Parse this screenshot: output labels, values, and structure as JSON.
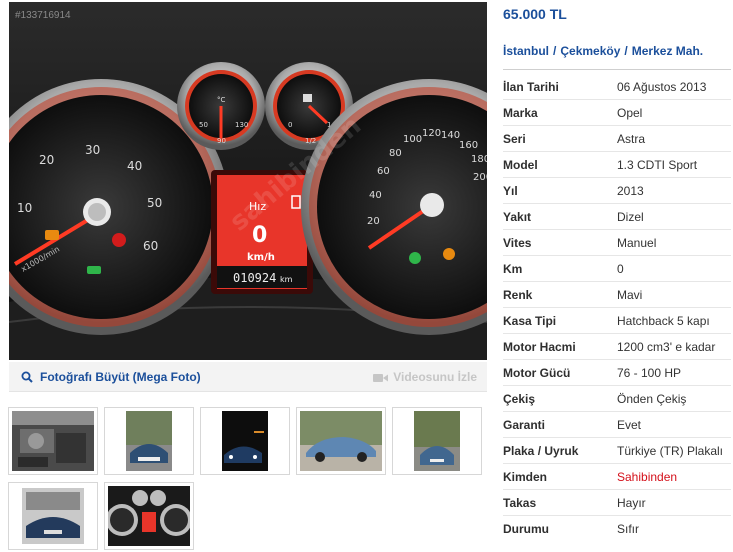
{
  "photo": {
    "id_watermark": "#133716914",
    "watermark_brand": "sahibinden",
    "display_speed_label": "Hız",
    "display_speed_value": "0",
    "display_speed_unit": "km/h",
    "display_odometer": "010924",
    "display_odometer_unit": "km",
    "speedo_ticks": [
      "20",
      "40",
      "60",
      "80",
      "100",
      "120",
      "140",
      "160",
      "180",
      "200"
    ],
    "tacho_ticks": [
      "10",
      "20",
      "30",
      "40",
      "50",
      "60"
    ],
    "tacho_unit": "x1000/min",
    "temp_gauge_ticks": [
      "50",
      "90",
      "130"
    ],
    "temp_gauge_unit": "°C",
    "fuel_gauge_ticks": [
      "0",
      "1/2",
      "1"
    ]
  },
  "photo_footer": {
    "enlarge_label": "Fotoğrafı Büyüt (Mega Foto)",
    "video_label": "Videosunu İzle"
  },
  "thumbnails": [
    {
      "name": "engine-bay"
    },
    {
      "name": "car-front-road"
    },
    {
      "name": "car-front-night"
    },
    {
      "name": "car-side-view"
    },
    {
      "name": "car-rear-view"
    },
    {
      "name": "car-front-garage"
    },
    {
      "name": "dashboard-gauges"
    }
  ],
  "listing": {
    "price": "65.000 TL",
    "location": [
      "İstanbul",
      "Çekmeköy",
      "Merkez Mah."
    ],
    "location_separator": "/",
    "specs": [
      {
        "key": "İlan Tarihi",
        "value": "06 Ağustos 2013"
      },
      {
        "key": "Marka",
        "value": "Opel"
      },
      {
        "key": "Seri",
        "value": "Astra"
      },
      {
        "key": "Model",
        "value": "1.3 CDTI Sport"
      },
      {
        "key": "Yıl",
        "value": "2013"
      },
      {
        "key": "Yakıt",
        "value": "Dizel"
      },
      {
        "key": "Vites",
        "value": "Manuel"
      },
      {
        "key": "Km",
        "value": "0"
      },
      {
        "key": "Renk",
        "value": "Mavi"
      },
      {
        "key": "Kasa Tipi",
        "value": "Hatchback 5 kapı"
      },
      {
        "key": "Motor Hacmi",
        "value": "1200 cm3' e kadar"
      },
      {
        "key": "Motor Gücü",
        "value": "76 - 100 HP"
      },
      {
        "key": "Çekiş",
        "value": "Önden Çekiş"
      },
      {
        "key": "Garanti",
        "value": "Evet"
      },
      {
        "key": "Plaka / Uyruk",
        "value": "Türkiye (TR) Plakalı"
      },
      {
        "key": "Kimden",
        "value": "Sahibinden"
      },
      {
        "key": "Takas",
        "value": "Hayır"
      },
      {
        "key": "Durumu",
        "value": "Sıfır"
      }
    ]
  },
  "colors": {
    "link_blue": "#1b4f9b",
    "seller_red": "#d4101a",
    "needle_red": "#ff3b24",
    "display_red": "#e8352a"
  }
}
